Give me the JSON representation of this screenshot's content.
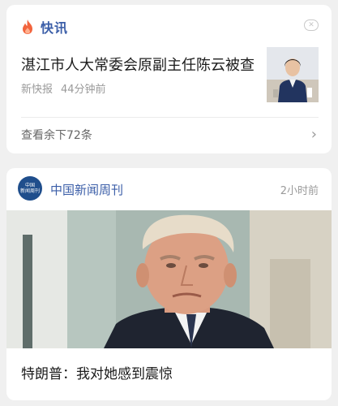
{
  "flash": {
    "title": "快讯",
    "headline": "湛江市人大常委会原副主任陈云被查",
    "source": "新快报",
    "time": "44分钟前",
    "more_label": "查看余下72条",
    "close_glyph": "✕",
    "chevron_glyph": "›",
    "accent_color": "#3b5ea8",
    "flame_color": "#f2643d"
  },
  "article": {
    "source_name": "中国新闻周刊",
    "logo_text": [
      "中国",
      "新闻周刊"
    ],
    "time": "2小时前",
    "title": "特朗普：我对她感到震惊"
  }
}
